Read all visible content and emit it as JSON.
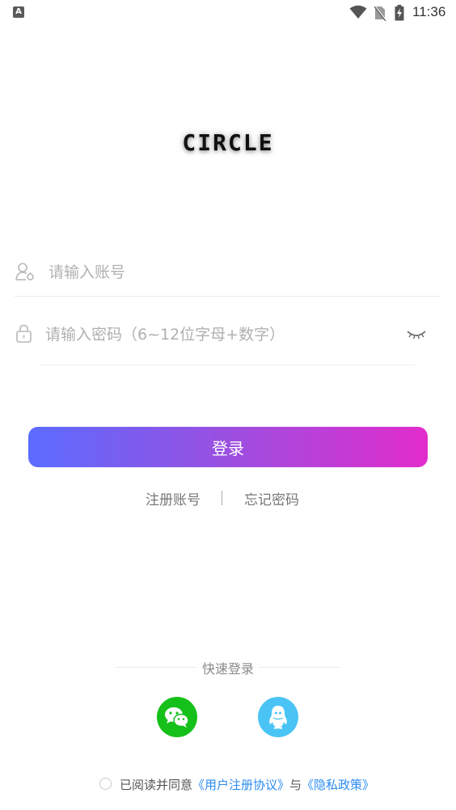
{
  "status_bar": {
    "time": "11:36",
    "app_icon_letter": "A",
    "icons": [
      "wifi-icon",
      "no-sim-icon",
      "battery-charging-icon"
    ]
  },
  "logo": {
    "text": "CIRCLE"
  },
  "account_field": {
    "placeholder": "请输入账号",
    "value": "",
    "icon": "user-icon"
  },
  "password_field": {
    "placeholder": "请输入密码（6~12位字母+数字）",
    "value": "",
    "icon": "lock-icon",
    "toggle_icon": "eye-closed-icon"
  },
  "login_button": {
    "label": "登录",
    "gradient": [
      "#5b6cff",
      "#9b4fe0",
      "#e22ccc"
    ]
  },
  "links": {
    "register": "注册账号",
    "forgot": "忘记密码"
  },
  "quick_login": {
    "label": "快速登录",
    "providers": [
      {
        "name": "wechat-icon",
        "color": "#16c01a"
      },
      {
        "name": "qq-icon",
        "color": "#4ac4f5"
      }
    ]
  },
  "agreement": {
    "prefix": "已阅读并同意",
    "user_agreement": "《用户注册协议》",
    "connector": "与",
    "privacy_policy": "《隐私政策》",
    "checked": false,
    "link_color": "#2c8cf0"
  }
}
